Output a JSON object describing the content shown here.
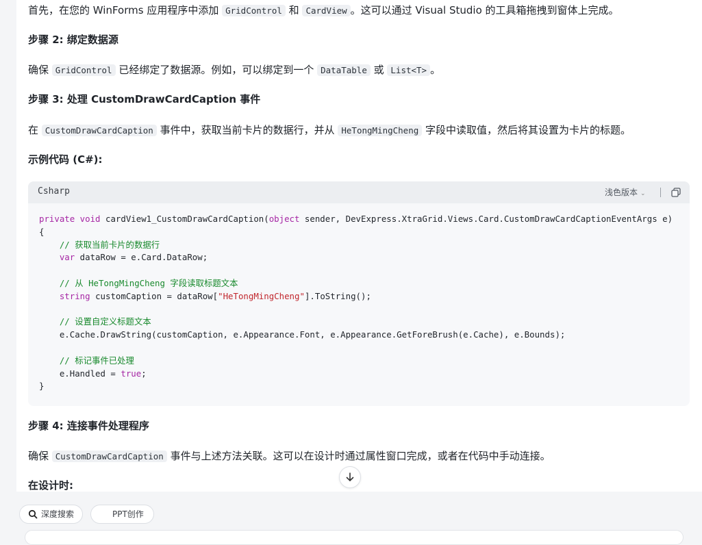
{
  "content": {
    "intro": {
      "p1": "首先，在您的 WinForms 应用程序中添加 ",
      "c1": "GridControl",
      "p2": " 和 ",
      "c2": "CardView",
      "p3": "。这可以通过 Visual Studio 的工具箱拖拽到窗体上完成。"
    },
    "step2": {
      "title": "步骤 2: 绑定数据源",
      "p1": "确保 ",
      "c1": "GridControl",
      "p2": " 已经绑定了数据源。例如，可以绑定到一个 ",
      "c2": "DataTable",
      "p3": " 或 ",
      "c3": "List<T>",
      "p4": "。"
    },
    "step3": {
      "title": "步骤 3: 处理 CustomDrawCardCaption 事件",
      "p1": "在 ",
      "c1": "CustomDrawCardCaption",
      "p2": " 事件中，获取当前卡片的数据行，并从 ",
      "c2": "HeTongMingCheng",
      "p3": " 字段中读取值，然后将其设置为卡片的标题。"
    },
    "example_title": "示例代码 (C#):",
    "code": {
      "language": "Csharp",
      "theme_label": "浅色版本",
      "lines": [
        {
          "kw": "private void ",
          "t": "cardView1_CustomDrawCardCaption(",
          "kw2": "object",
          "t2": " sender, DevExpress.XtraGrid.Views.Card.CustomDrawCardCaptionEventArgs e)"
        },
        {
          "t": "{"
        },
        {
          "cm": "    // 获取当前卡片的数据行"
        },
        {
          "kw": "    var",
          "t": " dataRow = e.Card.DataRow;"
        },
        {
          "t": ""
        },
        {
          "cm": "    // 从 HeTongMingCheng 字段读取标题文本"
        },
        {
          "kw": "    string",
          "t": " customCaption = dataRow[",
          "st": "\"HeTongMingCheng\"",
          "t2": "].ToString();"
        },
        {
          "t": ""
        },
        {
          "cm": "    // 设置自定义标题文本"
        },
        {
          "t": "    e.Cache.DrawString(customCaption, e.Appearance.Font, e.Appearance.GetForeBrush(e.Cache), e.Bounds);"
        },
        {
          "t": ""
        },
        {
          "cm": "    // 标记事件已处理"
        },
        {
          "t": "    e.Handled = ",
          "kw2": "true",
          "t2": ";"
        },
        {
          "t": "}"
        }
      ]
    },
    "step4": {
      "title": "步骤 4: 连接事件处理程序",
      "p1": "确保 ",
      "c1": "CustomDrawCardCaption",
      "p2": " 事件与上述方法关联。这可以在设计时通过属性窗口完成，或者在代码中手动连接。"
    },
    "design_time": "在设计时:"
  },
  "toolbar": {
    "deep_search": "深度搜索",
    "ppt": "PPT创作"
  },
  "colors": {
    "keyword": "#a626a4",
    "comment": "#1a8a2e",
    "string": "#c1272d",
    "inline_code_bg": "#eef0f3"
  },
  "icons": {
    "scroll_down": "arrow-down-icon",
    "copy": "copy-icon",
    "search": "search-icon",
    "chevron": "chevron-down-icon"
  }
}
